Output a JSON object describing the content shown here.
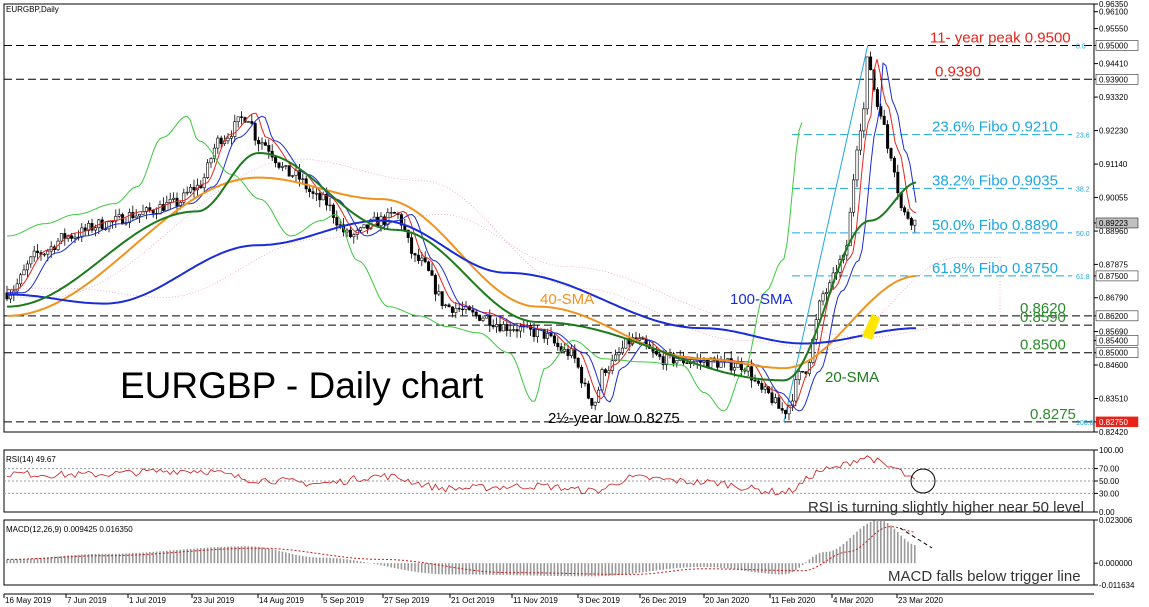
{
  "chart_data": [
    {
      "type": "candlestick",
      "header": "EURGBP,Daily",
      "title": "EURGBP - Daily chart",
      "ylim": [
        0.8242,
        0.9635
      ],
      "price_ticks": [
        "0.96350",
        "0.96100",
        "0.95550",
        "0.95000",
        "0.94410",
        "0.93900",
        "0.93320",
        "0.92230",
        "0.91140",
        "0.90055",
        "0.89223",
        "0.88960",
        "0.87875",
        "0.87500",
        "0.86790",
        "0.86200",
        "0.85690",
        "0.85400",
        "0.85000",
        "0.84600",
        "0.83510",
        "0.82750",
        "0.82420"
      ],
      "current_price": "0.89223",
      "levels": [
        {
          "value": 0.95,
          "label": "11- year peak 0.9500",
          "color": "#e8241a",
          "ratio": "0.0"
        },
        {
          "value": 0.939,
          "label": "0.9390",
          "color": "#e8241a"
        },
        {
          "value": 0.921,
          "label": "23.6% Fibo 0.9210",
          "color": "#1fa7e0",
          "ratio": "23.6"
        },
        {
          "value": 0.9035,
          "label": "38.2% Fibo 0.9035",
          "color": "#1fa7e0",
          "ratio": "38.2"
        },
        {
          "value": 0.889,
          "label": "50.0% Fibo 0.8890",
          "color": "#1fa7e0",
          "ratio": "50.0"
        },
        {
          "value": 0.875,
          "label": "61.8% Fibo 0.8750",
          "color": "#1fa7e0",
          "ratio": "61.8"
        },
        {
          "value": 0.862,
          "label": "0.8620",
          "color": "#2e8b2e"
        },
        {
          "value": 0.859,
          "label": "0.8590",
          "color": "#2e8b2e"
        },
        {
          "value": 0.85,
          "label": "0.8500",
          "color": "#2e8b2e"
        },
        {
          "value": 0.8275,
          "label": "0.8275",
          "color": "#2e8b2e",
          "ratio": "100.0"
        }
      ],
      "annotations": {
        "sma40": "40-SMA",
        "sma100": "100-SMA",
        "sma20": "20-SMA",
        "low": "2½-year low 0.8275"
      },
      "x_dates": [
        "16 May 2019",
        "7 Jun 2019",
        "1 Jul 2019",
        "23 Jul 2019",
        "14 Aug 2019",
        "5 Sep 2019",
        "27 Sep 2019",
        "21 Oct 2019",
        "11 Nov 2019",
        "3 Dec 2019",
        "26 Dec 2019",
        "20 Jan 2020",
        "11 Feb 2020",
        "4 Mar 2020",
        "23 Mar 2020"
      ],
      "series": {
        "close_anchors": [
          [
            "2019-05-16",
            0.8695
          ],
          [
            "2019-05-28",
            0.8825
          ],
          [
            "2019-06-07",
            0.888
          ],
          [
            "2019-06-20",
            0.892
          ],
          [
            "2019-07-01",
            0.895
          ],
          [
            "2019-07-15",
            0.8985
          ],
          [
            "2019-07-23",
            0.904
          ],
          [
            "2019-08-01",
            0.92
          ],
          [
            "2019-08-10",
            0.927
          ],
          [
            "2019-08-14",
            0.919
          ],
          [
            "2019-08-26",
            0.908
          ],
          [
            "2019-09-05",
            0.9
          ],
          [
            "2019-09-16",
            0.888
          ],
          [
            "2019-09-27",
            0.893
          ],
          [
            "2019-10-02",
            0.895
          ],
          [
            "2019-10-10",
            0.88
          ],
          [
            "2019-10-21",
            0.865
          ],
          [
            "2019-11-01",
            0.862
          ],
          [
            "2019-11-11",
            0.8585
          ],
          [
            "2019-11-22",
            0.8565
          ],
          [
            "2019-12-03",
            0.85
          ],
          [
            "2019-12-12",
            0.834
          ],
          [
            "2019-12-16",
            0.845
          ],
          [
            "2019-12-26",
            0.854
          ],
          [
            "2020-01-06",
            0.848
          ],
          [
            "2020-01-20",
            0.847
          ],
          [
            "2020-02-03",
            0.846
          ],
          [
            "2020-02-11",
            0.837
          ],
          [
            "2020-02-18",
            0.831
          ],
          [
            "2020-02-25",
            0.844
          ],
          [
            "2020-03-04",
            0.87
          ],
          [
            "2020-03-10",
            0.88
          ],
          [
            "2020-03-17",
            0.925
          ],
          [
            "2020-03-19",
            0.945
          ],
          [
            "2020-03-23",
            0.93
          ],
          [
            "2020-03-27",
            0.915
          ],
          [
            "2020-04-01",
            0.895
          ],
          [
            "2020-04-06",
            0.8922
          ]
        ],
        "sma20_anchors": [
          [
            "2019-05-16",
            0.865
          ],
          [
            "2019-07-23",
            0.896
          ],
          [
            "2019-08-14",
            0.915
          ],
          [
            "2019-10-02",
            0.89
          ],
          [
            "2019-11-22",
            0.86
          ],
          [
            "2020-02-18",
            0.841
          ],
          [
            "2020-03-20",
            0.893
          ],
          [
            "2020-04-06",
            0.9055
          ]
        ],
        "sma40_anchors": [
          [
            "2019-05-16",
            0.862
          ],
          [
            "2019-08-14",
            0.907
          ],
          [
            "2019-09-27",
            0.9
          ],
          [
            "2019-11-22",
            0.865
          ],
          [
            "2020-01-20",
            0.848
          ],
          [
            "2020-02-18",
            0.845
          ],
          [
            "2020-04-06",
            0.875
          ]
        ],
        "sma100_anchors": [
          [
            "2019-05-16",
            0.869
          ],
          [
            "2019-06-20",
            0.866
          ],
          [
            "2019-08-14",
            0.885
          ],
          [
            "2019-09-27",
            0.893
          ],
          [
            "2019-11-11",
            0.876
          ],
          [
            "2020-01-20",
            0.858
          ],
          [
            "2020-02-25",
            0.853
          ],
          [
            "2020-04-06",
            0.858
          ]
        ]
      }
    },
    {
      "type": "line",
      "header": "RSI(14) 49.67",
      "ticks": [
        "100.00",
        "70.00",
        "50.00",
        "30.00",
        "0.00"
      ],
      "ylim": [
        0,
        100
      ],
      "note": "RSI is turning slightly higher near 50 level",
      "series": [
        {
          "values_anchors": [
            [
              "2019-05-16",
              62
            ],
            [
              "2019-06-07",
              60
            ],
            [
              "2019-07-23",
              67
            ],
            [
              "2019-08-14",
              52
            ],
            [
              "2019-09-05",
              46
            ],
            [
              "2019-09-27",
              58
            ],
            [
              "2019-10-21",
              38
            ],
            [
              "2019-11-22",
              42
            ],
            [
              "2019-12-12",
              34
            ],
            [
              "2019-12-26",
              55
            ],
            [
              "2020-01-20",
              48
            ],
            [
              "2020-02-18",
              32
            ],
            [
              "2020-03-04",
              68
            ],
            [
              "2020-03-19",
              88
            ],
            [
              "2020-03-27",
              72
            ],
            [
              "2020-04-06",
              49.67
            ]
          ]
        }
      ]
    },
    {
      "type": "macd",
      "header": "MACD(12,26,9) 0.009425 0.016350",
      "ticks": [
        "0.023006",
        "0.000000",
        "-0.011634"
      ],
      "ylim": [
        -0.011634,
        0.023006
      ],
      "note": "MACD falls below trigger line",
      "series": [
        {
          "name": "histogram",
          "values_anchors": [
            [
              "2019-05-16",
              0.002
            ],
            [
              "2019-06-20",
              0.005
            ],
            [
              "2019-08-10",
              0.009
            ],
            [
              "2019-09-05",
              0.003
            ],
            [
              "2019-10-21",
              -0.006
            ],
            [
              "2019-12-12",
              -0.007
            ],
            [
              "2020-01-20",
              -0.002
            ],
            [
              "2020-02-18",
              -0.006
            ],
            [
              "2020-03-04",
              0.006
            ],
            [
              "2020-03-23",
              0.023
            ],
            [
              "2020-04-06",
              0.009425
            ]
          ]
        },
        {
          "name": "signal",
          "values_anchors": [
            [
              "2019-05-16",
              0.002
            ],
            [
              "2019-06-20",
              0.004
            ],
            [
              "2019-08-14",
              0.008
            ],
            [
              "2019-09-27",
              0.002
            ],
            [
              "2019-11-11",
              -0.005
            ],
            [
              "2019-12-26",
              -0.006
            ],
            [
              "2020-01-20",
              -0.003
            ],
            [
              "2020-02-25",
              -0.004
            ],
            [
              "2020-03-12",
              0.006
            ],
            [
              "2020-03-27",
              0.0195
            ],
            [
              "2020-04-06",
              0.01635
            ]
          ]
        }
      ]
    }
  ]
}
